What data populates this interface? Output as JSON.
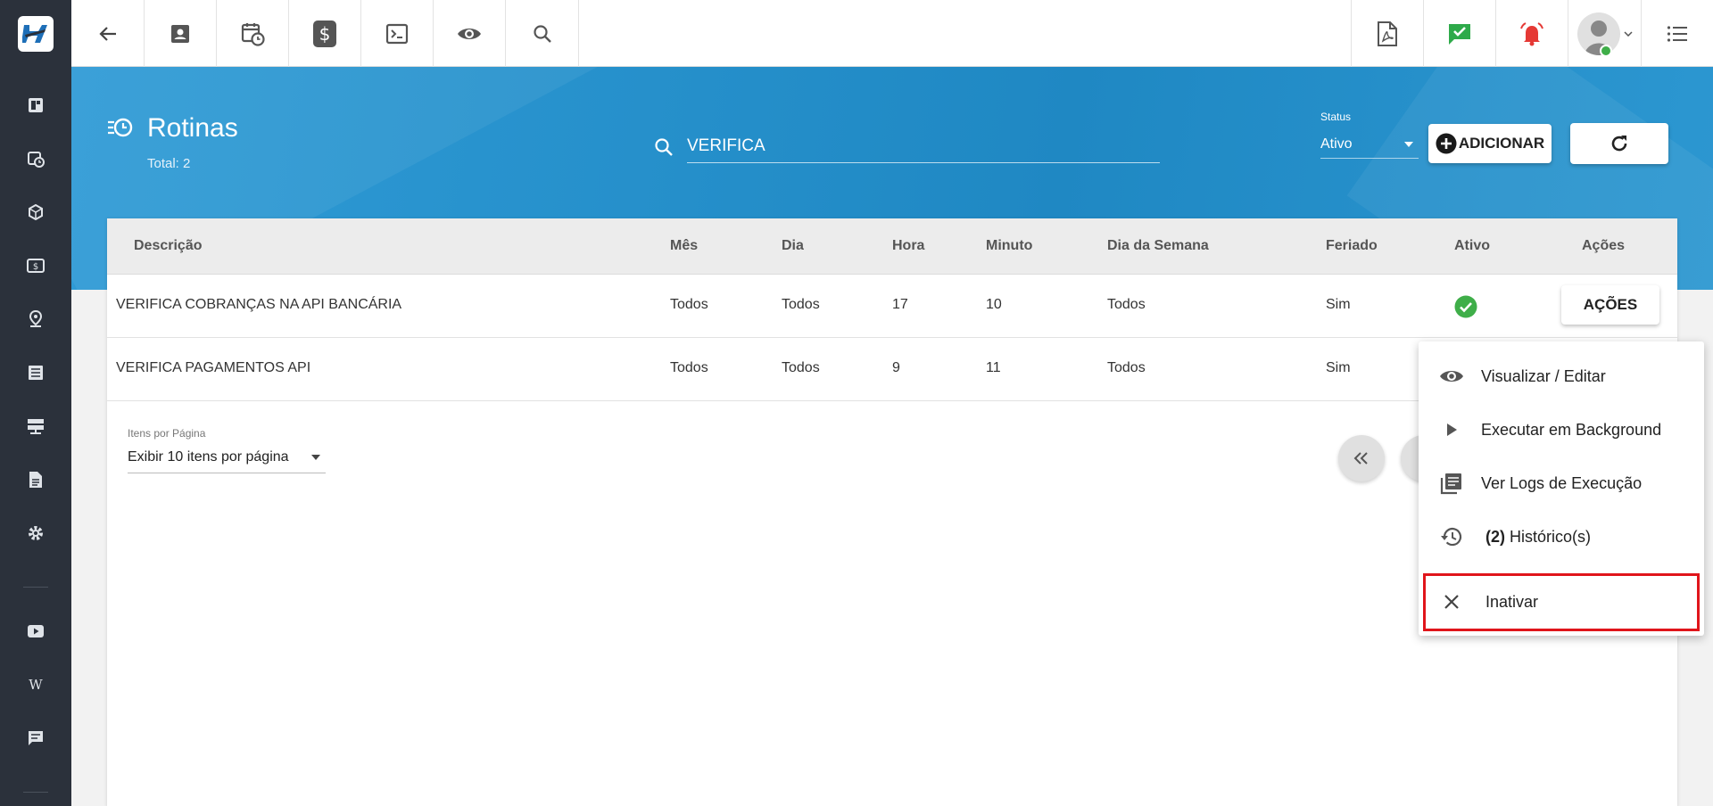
{
  "header": {
    "title": "Rotinas",
    "total": "Total: 2",
    "search_value": "VERIFICA",
    "status_label": "Status",
    "status_value": "Ativo",
    "add_label": "ADICIONAR"
  },
  "table": {
    "columns": [
      "Descrição",
      "Mês",
      "Dia",
      "Hora",
      "Minuto",
      "Dia da Semana",
      "Feriado",
      "Ativo",
      "Ações"
    ],
    "rows": [
      {
        "descricao": "VERIFICA COBRANÇAS NA API BANCÁRIA",
        "mes": "Todos",
        "dia": "Todos",
        "hora": "17",
        "minuto": "10",
        "dia_semana": "Todos",
        "feriado": "Sim",
        "acoes": "AÇÕES"
      },
      {
        "descricao": "VERIFICA PAGAMENTOS API",
        "mes": "Todos",
        "dia": "Todos",
        "hora": "9",
        "minuto": "11",
        "dia_semana": "Todos",
        "feriado": "Sim"
      }
    ]
  },
  "pagination": {
    "label": "Itens por Página",
    "value": "Exibir 10 itens por página"
  },
  "menu": {
    "items": [
      {
        "label": "Visualizar / Editar",
        "icon": "eye-icon"
      },
      {
        "label": "Executar em Background",
        "icon": "play-icon"
      },
      {
        "label": "Ver Logs de Execução",
        "icon": "logs-icon"
      },
      {
        "label_count": "(2)",
        "label": "Histórico(s)",
        "icon": "history-icon"
      },
      {
        "label": "Inativar",
        "icon": "close-icon"
      }
    ]
  },
  "colors": {
    "sidebar": "#2b313b",
    "band": "#2590cc",
    "active_check": "#3fae49",
    "alert_red": "#e53935",
    "chat_green": "#2eaa4a",
    "highlight": "#e0151b"
  }
}
